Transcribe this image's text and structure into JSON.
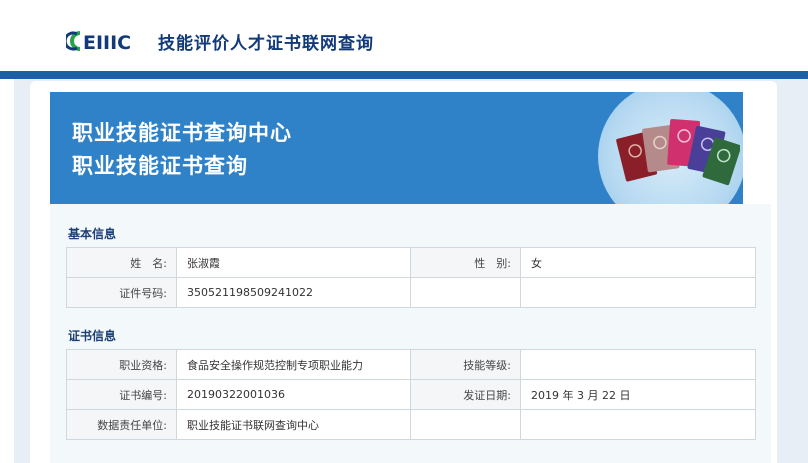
{
  "header": {
    "logo_text": "EIIIC",
    "site_title": "技能评价人才证书联网查询"
  },
  "banner": {
    "title_line1": "职业技能证书查询中心",
    "title_line2": "职业技能证书查询"
  },
  "basic_info": {
    "section_title": "基本信息",
    "name_label": "姓　名:",
    "name_value": "张淑霞",
    "gender_label": "性　别:",
    "gender_value": "女",
    "id_label": "证件号码:",
    "id_value": "350521198509241022"
  },
  "cert_info": {
    "section_title": "证书信息",
    "qualification_label": "职业资格:",
    "qualification_value": "食品安全操作规范控制专项职业能力",
    "skill_level_label": "技能等级:",
    "skill_level_value": "",
    "cert_no_label": "证书编号:",
    "cert_no_value": "20190322001036",
    "issue_date_label": "发证日期:",
    "issue_date_value": "2019 年 3 月 22 日",
    "unit_label": "数据责任单位:",
    "unit_value": "职业技能证书联网查询中心"
  },
  "colors": {
    "brand_blue": "#1d5ea8",
    "banner_blue": "#2f82c8",
    "logo_green": "#2aa34a"
  }
}
